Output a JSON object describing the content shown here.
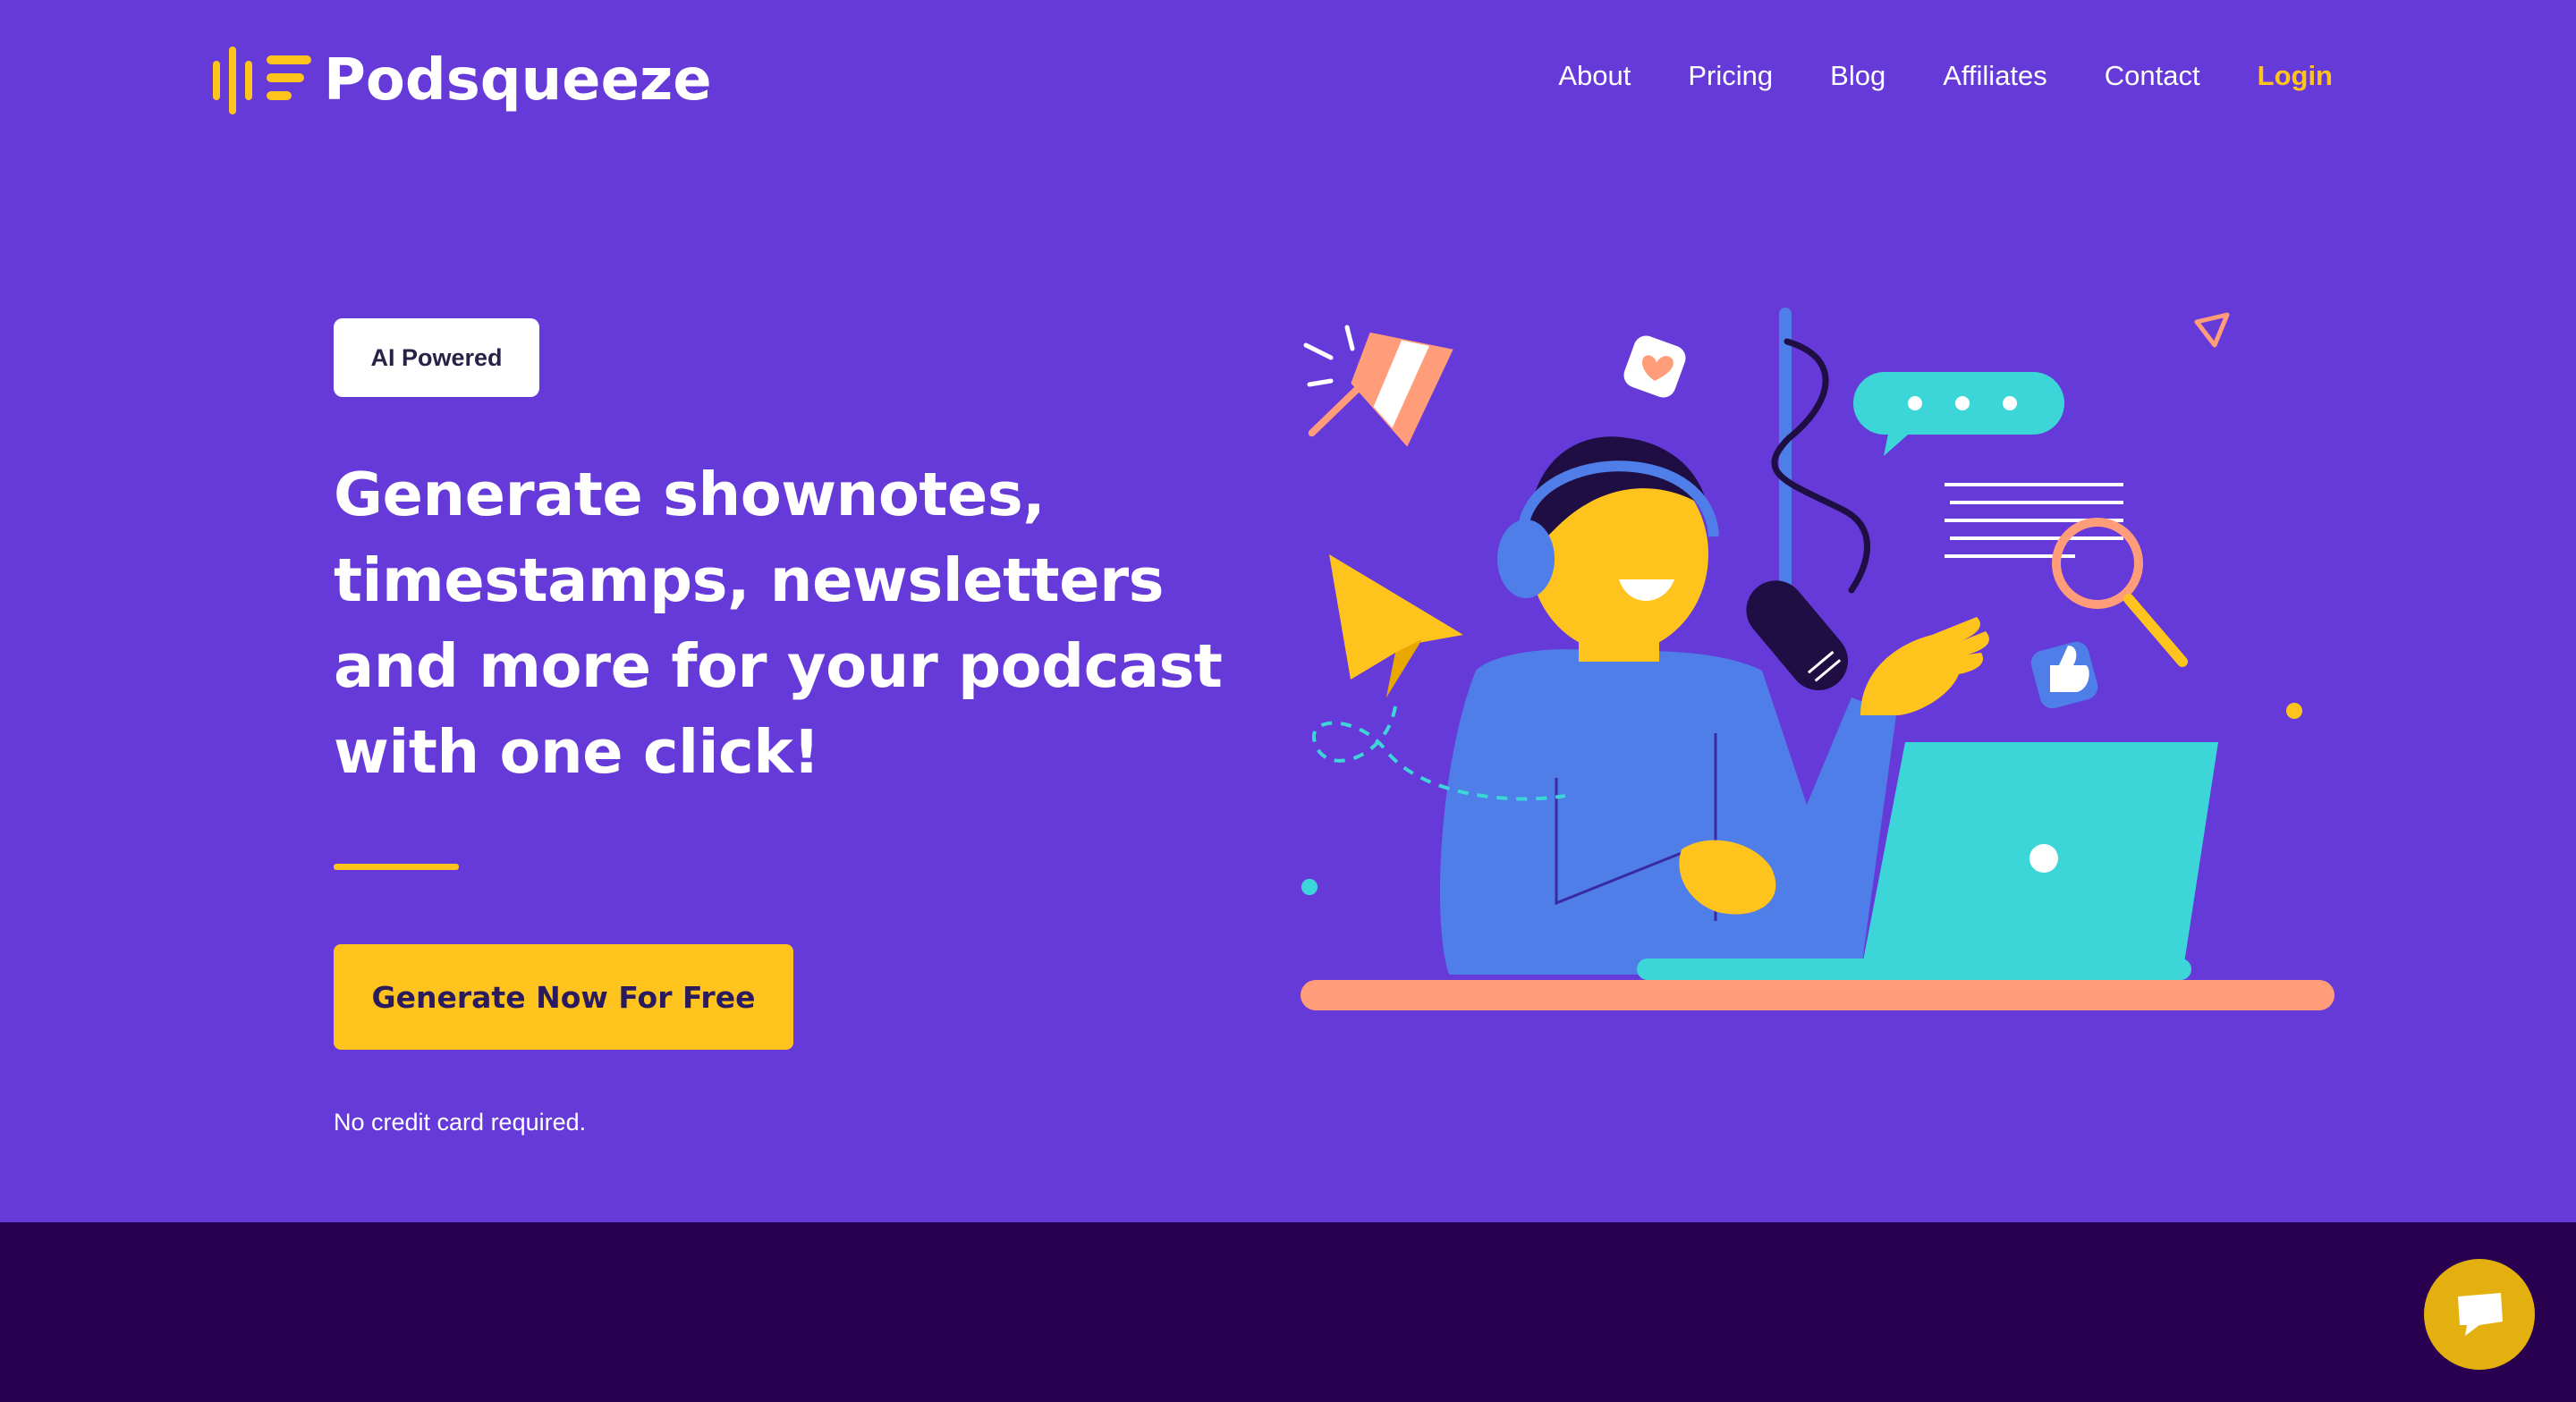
{
  "brand": {
    "name": "Podsqueeze"
  },
  "nav": {
    "items": [
      "About",
      "Pricing",
      "Blog",
      "Affiliates",
      "Contact"
    ],
    "login": "Login"
  },
  "hero": {
    "badge": "AI Powered",
    "headline": "Generate shownotes, timestamps, newsletters and more for your podcast with one click!",
    "cta": "Generate Now For Free",
    "note": "No credit card required."
  },
  "colors": {
    "background": "#653ad8",
    "accent": "#ffc31d",
    "footer_band": "#29004f",
    "teal": "#3dd6d8",
    "salmon": "#ff9d7a",
    "blue": "#4f7ee8"
  },
  "icons": {
    "logo": "sound-wave-icon",
    "chat": "chat-bubble-icon"
  }
}
